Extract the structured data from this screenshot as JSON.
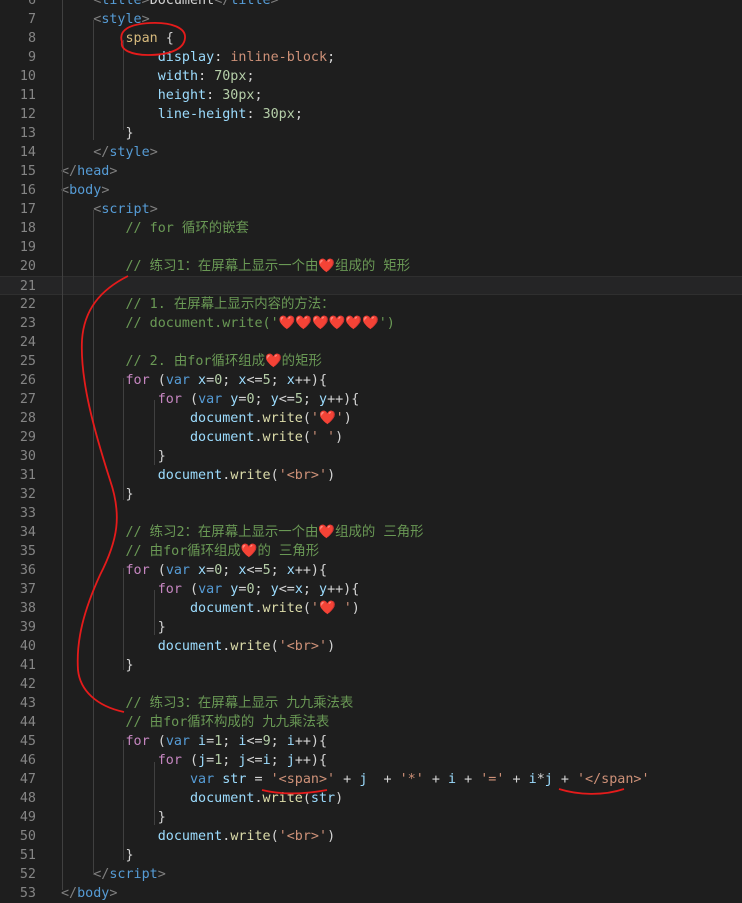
{
  "editor": {
    "lines": [
      {
        "n": "6",
        "tokens": [
          [
            "t-punc",
            "    <"
          ],
          [
            "t-tag",
            "title"
          ],
          [
            "t-punc",
            ">"
          ],
          [
            "t-text",
            "Document"
          ],
          [
            "t-punc",
            "</"
          ],
          [
            "t-tag",
            "title"
          ],
          [
            "t-punc",
            ">"
          ]
        ]
      },
      {
        "n": "7",
        "tokens": [
          [
            "t-punc",
            "    <"
          ],
          [
            "t-tag",
            "style"
          ],
          [
            "t-punc",
            ">"
          ]
        ]
      },
      {
        "n": "8",
        "tokens": [
          [
            "t-text",
            "        "
          ],
          [
            "t-sel",
            "span"
          ],
          [
            "t-text",
            " {"
          ]
        ]
      },
      {
        "n": "9",
        "tokens": [
          [
            "t-text",
            "            "
          ],
          [
            "t-prop",
            "display"
          ],
          [
            "t-text",
            ": "
          ],
          [
            "t-str",
            "inline-block"
          ],
          [
            "t-text",
            ";"
          ]
        ]
      },
      {
        "n": "10",
        "tokens": [
          [
            "t-text",
            "            "
          ],
          [
            "t-prop",
            "width"
          ],
          [
            "t-text",
            ": "
          ],
          [
            "t-val",
            "70px"
          ],
          [
            "t-text",
            ";"
          ]
        ]
      },
      {
        "n": "11",
        "tokens": [
          [
            "t-text",
            "            "
          ],
          [
            "t-prop",
            "height"
          ],
          [
            "t-text",
            ": "
          ],
          [
            "t-val",
            "30px"
          ],
          [
            "t-text",
            ";"
          ]
        ]
      },
      {
        "n": "12",
        "tokens": [
          [
            "t-text",
            "            "
          ],
          [
            "t-prop",
            "line-height"
          ],
          [
            "t-text",
            ": "
          ],
          [
            "t-val",
            "30px"
          ],
          [
            "t-text",
            ";"
          ]
        ]
      },
      {
        "n": "13",
        "tokens": [
          [
            "t-text",
            "        }"
          ]
        ]
      },
      {
        "n": "14",
        "tokens": [
          [
            "t-punc",
            "    </"
          ],
          [
            "t-tag",
            "style"
          ],
          [
            "t-punc",
            ">"
          ]
        ]
      },
      {
        "n": "15",
        "tokens": [
          [
            "t-punc",
            "</"
          ],
          [
            "t-tag",
            "head"
          ],
          [
            "t-punc",
            ">"
          ]
        ]
      },
      {
        "n": "16",
        "tokens": [
          [
            "t-punc",
            "<"
          ],
          [
            "t-tag",
            "body"
          ],
          [
            "t-punc",
            ">"
          ]
        ]
      },
      {
        "n": "17",
        "tokens": [
          [
            "t-punc",
            "    <"
          ],
          [
            "t-tag",
            "script"
          ],
          [
            "t-punc",
            ">"
          ]
        ]
      },
      {
        "n": "18",
        "tokens": [
          [
            "t-com",
            "        // for 循环的嵌套"
          ]
        ]
      },
      {
        "n": "19",
        "tokens": []
      },
      {
        "n": "20",
        "tokens": [
          [
            "t-com",
            "        // 练习1：在屏幕上显示一个由❤️组成的 矩形"
          ]
        ]
      },
      {
        "n": "21",
        "tokens": [],
        "current": true
      },
      {
        "n": "22",
        "tokens": [
          [
            "t-com",
            "        // 1. 在屏幕上显示内容的方法："
          ]
        ]
      },
      {
        "n": "23",
        "tokens": [
          [
            "t-com",
            "        // document.write('❤️❤️❤️❤️❤️❤️')"
          ]
        ]
      },
      {
        "n": "24",
        "tokens": []
      },
      {
        "n": "25",
        "tokens": [
          [
            "t-com",
            "        // 2. 由for循环组成❤️的矩形"
          ]
        ]
      },
      {
        "n": "26",
        "tokens": [
          [
            "t-kw",
            "        for"
          ],
          [
            "t-text",
            " ("
          ],
          [
            "t-st",
            "var"
          ],
          [
            "t-var",
            " x"
          ],
          [
            "t-text",
            "="
          ],
          [
            "t-num",
            "0"
          ],
          [
            "t-text",
            "; "
          ],
          [
            "t-var",
            "x"
          ],
          [
            "t-text",
            "<="
          ],
          [
            "t-num",
            "5"
          ],
          [
            "t-text",
            "; "
          ],
          [
            "t-var",
            "x"
          ],
          [
            "t-text",
            "++){"
          ]
        ]
      },
      {
        "n": "27",
        "tokens": [
          [
            "t-kw",
            "            for"
          ],
          [
            "t-text",
            " ("
          ],
          [
            "t-st",
            "var"
          ],
          [
            "t-var",
            " y"
          ],
          [
            "t-text",
            "="
          ],
          [
            "t-num",
            "0"
          ],
          [
            "t-text",
            "; "
          ],
          [
            "t-var",
            "y"
          ],
          [
            "t-text",
            "<="
          ],
          [
            "t-num",
            "5"
          ],
          [
            "t-text",
            "; "
          ],
          [
            "t-var",
            "y"
          ],
          [
            "t-text",
            "++){"
          ]
        ]
      },
      {
        "n": "28",
        "tokens": [
          [
            "t-var",
            "                document"
          ],
          [
            "t-text",
            "."
          ],
          [
            "t-fn",
            "write"
          ],
          [
            "t-text",
            "("
          ],
          [
            "t-str",
            "'❤️'"
          ],
          [
            "t-text",
            ")"
          ]
        ]
      },
      {
        "n": "29",
        "tokens": [
          [
            "t-var",
            "                document"
          ],
          [
            "t-text",
            "."
          ],
          [
            "t-fn",
            "write"
          ],
          [
            "t-text",
            "("
          ],
          [
            "t-str",
            "' '"
          ],
          [
            "t-text",
            ")"
          ]
        ]
      },
      {
        "n": "30",
        "tokens": [
          [
            "t-text",
            "            }"
          ]
        ]
      },
      {
        "n": "31",
        "tokens": [
          [
            "t-var",
            "            document"
          ],
          [
            "t-text",
            "."
          ],
          [
            "t-fn",
            "write"
          ],
          [
            "t-text",
            "("
          ],
          [
            "t-str",
            "'<br>'"
          ],
          [
            "t-text",
            ")"
          ]
        ]
      },
      {
        "n": "32",
        "tokens": [
          [
            "t-text",
            "        }"
          ]
        ]
      },
      {
        "n": "33",
        "tokens": []
      },
      {
        "n": "34",
        "tokens": [
          [
            "t-com",
            "        // 练习2：在屏幕上显示一个由❤️组成的 三角形"
          ]
        ]
      },
      {
        "n": "35",
        "tokens": [
          [
            "t-com",
            "        // 由for循环组成❤️的 三角形"
          ]
        ]
      },
      {
        "n": "36",
        "tokens": [
          [
            "t-kw",
            "        for"
          ],
          [
            "t-text",
            " ("
          ],
          [
            "t-st",
            "var"
          ],
          [
            "t-var",
            " x"
          ],
          [
            "t-text",
            "="
          ],
          [
            "t-num",
            "0"
          ],
          [
            "t-text",
            "; "
          ],
          [
            "t-var",
            "x"
          ],
          [
            "t-text",
            "<="
          ],
          [
            "t-num",
            "5"
          ],
          [
            "t-text",
            "; "
          ],
          [
            "t-var",
            "x"
          ],
          [
            "t-text",
            "++){"
          ]
        ]
      },
      {
        "n": "37",
        "tokens": [
          [
            "t-kw",
            "            for"
          ],
          [
            "t-text",
            " ("
          ],
          [
            "t-st",
            "var"
          ],
          [
            "t-var",
            " y"
          ],
          [
            "t-text",
            "="
          ],
          [
            "t-num",
            "0"
          ],
          [
            "t-text",
            "; "
          ],
          [
            "t-var",
            "y"
          ],
          [
            "t-text",
            "<="
          ],
          [
            "t-var",
            "x"
          ],
          [
            "t-text",
            "; "
          ],
          [
            "t-var",
            "y"
          ],
          [
            "t-text",
            "++){"
          ]
        ]
      },
      {
        "n": "38",
        "tokens": [
          [
            "t-var",
            "                document"
          ],
          [
            "t-text",
            "."
          ],
          [
            "t-fn",
            "write"
          ],
          [
            "t-text",
            "("
          ],
          [
            "t-str",
            "'❤️ '"
          ],
          [
            "t-text",
            ")"
          ]
        ]
      },
      {
        "n": "39",
        "tokens": [
          [
            "t-text",
            "            }"
          ]
        ]
      },
      {
        "n": "40",
        "tokens": [
          [
            "t-var",
            "            document"
          ],
          [
            "t-text",
            "."
          ],
          [
            "t-fn",
            "write"
          ],
          [
            "t-text",
            "("
          ],
          [
            "t-str",
            "'<br>'"
          ],
          [
            "t-text",
            ")"
          ]
        ]
      },
      {
        "n": "41",
        "tokens": [
          [
            "t-text",
            "        }"
          ]
        ]
      },
      {
        "n": "42",
        "tokens": []
      },
      {
        "n": "43",
        "tokens": [
          [
            "t-com",
            "        // 练习3：在屏幕上显示 九九乘法表"
          ]
        ]
      },
      {
        "n": "44",
        "tokens": [
          [
            "t-com",
            "        // 由for循环构成的 九九乘法表"
          ]
        ]
      },
      {
        "n": "45",
        "tokens": [
          [
            "t-kw",
            "        for"
          ],
          [
            "t-text",
            " ("
          ],
          [
            "t-st",
            "var"
          ],
          [
            "t-var",
            " i"
          ],
          [
            "t-text",
            "="
          ],
          [
            "t-num",
            "1"
          ],
          [
            "t-text",
            "; "
          ],
          [
            "t-var",
            "i"
          ],
          [
            "t-text",
            "<="
          ],
          [
            "t-num",
            "9"
          ],
          [
            "t-text",
            "; "
          ],
          [
            "t-var",
            "i"
          ],
          [
            "t-text",
            "++){"
          ]
        ]
      },
      {
        "n": "46",
        "tokens": [
          [
            "t-kw",
            "            for"
          ],
          [
            "t-text",
            " ("
          ],
          [
            "t-var",
            "j"
          ],
          [
            "t-text",
            "="
          ],
          [
            "t-num",
            "1"
          ],
          [
            "t-text",
            "; "
          ],
          [
            "t-var",
            "j"
          ],
          [
            "t-text",
            "<="
          ],
          [
            "t-var",
            "i"
          ],
          [
            "t-text",
            "; "
          ],
          [
            "t-var",
            "j"
          ],
          [
            "t-text",
            "++){"
          ]
        ]
      },
      {
        "n": "47",
        "tokens": [
          [
            "t-st",
            "                var"
          ],
          [
            "t-var",
            " str"
          ],
          [
            "t-text",
            " = "
          ],
          [
            "t-str",
            "'<span>'"
          ],
          [
            "t-text",
            " + "
          ],
          [
            "t-var",
            "j"
          ],
          [
            "t-text",
            "  + "
          ],
          [
            "t-str",
            "'*'"
          ],
          [
            "t-text",
            " + "
          ],
          [
            "t-var",
            "i"
          ],
          [
            "t-text",
            " + "
          ],
          [
            "t-str",
            "'='"
          ],
          [
            "t-text",
            " + "
          ],
          [
            "t-var",
            "i"
          ],
          [
            "t-text",
            "*"
          ],
          [
            "t-var",
            "j"
          ],
          [
            "t-text",
            " + "
          ],
          [
            "t-str",
            "'</span>'"
          ]
        ]
      },
      {
        "n": "48",
        "tokens": [
          [
            "t-var",
            "                document"
          ],
          [
            "t-text",
            "."
          ],
          [
            "t-fn",
            "write"
          ],
          [
            "t-text",
            "("
          ],
          [
            "t-var",
            "str"
          ],
          [
            "t-text",
            ")"
          ]
        ]
      },
      {
        "n": "49",
        "tokens": [
          [
            "t-text",
            "            }"
          ]
        ]
      },
      {
        "n": "50",
        "tokens": [
          [
            "t-var",
            "            document"
          ],
          [
            "t-text",
            "."
          ],
          [
            "t-fn",
            "write"
          ],
          [
            "t-text",
            "("
          ],
          [
            "t-str",
            "'<br>'"
          ],
          [
            "t-text",
            ")"
          ]
        ]
      },
      {
        "n": "51",
        "tokens": [
          [
            "t-text",
            "        }"
          ]
        ]
      },
      {
        "n": "52",
        "tokens": [
          [
            "t-punc",
            "    </"
          ],
          [
            "t-tag",
            "script"
          ],
          [
            "t-punc",
            ">"
          ]
        ]
      },
      {
        "n": "53",
        "tokens": [
          [
            "t-punc",
            "</"
          ],
          [
            "t-tag",
            "body"
          ],
          [
            "t-punc",
            ">"
          ]
        ]
      }
    ]
  },
  "theme": {
    "background": "#1e1e1e",
    "annotation_color": "#e51b1b"
  }
}
